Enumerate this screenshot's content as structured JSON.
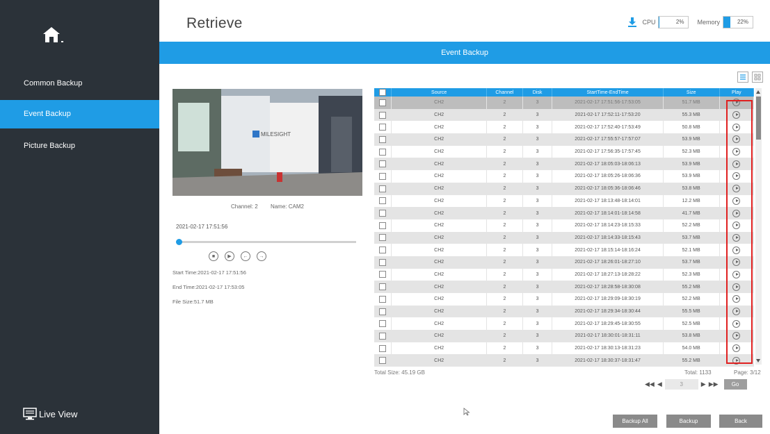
{
  "sidebar": {
    "items": [
      {
        "label": "Common Backup"
      },
      {
        "label": "Event Backup"
      },
      {
        "label": "Picture Backup"
      }
    ],
    "live_view": "Live View"
  },
  "header": {
    "title": "Retrieve",
    "cpu_label": "CPU",
    "cpu_value": "2%",
    "memory_label": "Memory",
    "memory_value": "22%",
    "accent": "#1f9ce5"
  },
  "banner": "Event Backup",
  "preview": {
    "channel": "Channel: 2",
    "name": "Name: CAM2",
    "current_time": "2021-02-17 17:51:56",
    "start_time": "Start Time:2021-02-17 17:51:56",
    "end_time": "End Time:2021-02-17 17:53:05",
    "file_size": "File Size:51.7 MB"
  },
  "table": {
    "columns": [
      "Source",
      "Channel",
      "Disk",
      "StartTime-EndTime",
      "Size",
      "Play"
    ],
    "rows": [
      [
        "CH2",
        "2",
        "3",
        "2021-02-17 17:51:56-17:53:05",
        "51.7 MB"
      ],
      [
        "CH2",
        "2",
        "3",
        "2021-02-17 17:52:11-17:53:20",
        "55.3 MB"
      ],
      [
        "CH2",
        "2",
        "3",
        "2021-02-17 17:52:40-17:53:49",
        "50.8 MB"
      ],
      [
        "CH2",
        "2",
        "3",
        "2021-02-17 17:55:57-17:57:07",
        "53.9 MB"
      ],
      [
        "CH2",
        "2",
        "3",
        "2021-02-17 17:56:35-17:57:45",
        "52.3 MB"
      ],
      [
        "CH2",
        "2",
        "3",
        "2021-02-17 18:05:03-18:06:13",
        "53.9 MB"
      ],
      [
        "CH2",
        "2",
        "3",
        "2021-02-17 18:05:26-18:06:36",
        "53.9 MB"
      ],
      [
        "CH2",
        "2",
        "3",
        "2021-02-17 18:05:36-18:06:46",
        "53.8 MB"
      ],
      [
        "CH2",
        "2",
        "3",
        "2021-02-17 18:13:48-18:14:01",
        "12.2 MB"
      ],
      [
        "CH2",
        "2",
        "3",
        "2021-02-17 18:14:01-18:14:58",
        "41.7 MB"
      ],
      [
        "CH2",
        "2",
        "3",
        "2021-02-17 18:14:23-18:15:33",
        "52.2 MB"
      ],
      [
        "CH2",
        "2",
        "3",
        "2021-02-17 18:14:33-18:15:43",
        "53.7 MB"
      ],
      [
        "CH2",
        "2",
        "3",
        "2021-02-17 18:15:14-18:16:24",
        "52.1 MB"
      ],
      [
        "CH2",
        "2",
        "3",
        "2021-02-17 18:26:01-18:27:10",
        "53.7 MB"
      ],
      [
        "CH2",
        "2",
        "3",
        "2021-02-17 18:27:13-18:28:22",
        "52.3 MB"
      ],
      [
        "CH2",
        "2",
        "3",
        "2021-02-17 18:28:58-18:30:08",
        "55.2 MB"
      ],
      [
        "CH2",
        "2",
        "3",
        "2021-02-17 18:29:09-18:30:19",
        "52.2 MB"
      ],
      [
        "CH2",
        "2",
        "3",
        "2021-02-17 18:29:34-18:30:44",
        "55.5 MB"
      ],
      [
        "CH2",
        "2",
        "3",
        "2021-02-17 18:29:45-18:30:55",
        "52.5 MB"
      ],
      [
        "CH2",
        "2",
        "3",
        "2021-02-17 18:30:01-18:31:11",
        "53.8 MB"
      ],
      [
        "CH2",
        "2",
        "3",
        "2021-02-17 18:30:13-18:31:23",
        "54.0 MB"
      ],
      [
        "CH2",
        "2",
        "3",
        "2021-02-17 18:30:37-18:31:47",
        "55.2 MB"
      ]
    ]
  },
  "footer": {
    "total_size": "Total Size: 45.19 GB",
    "total": "Total: 1133",
    "page": "Page: 3/12",
    "page_input": "3",
    "go": "Go"
  },
  "buttons": {
    "backup_all": "Backup All",
    "backup": "Backup",
    "back": "Back"
  }
}
